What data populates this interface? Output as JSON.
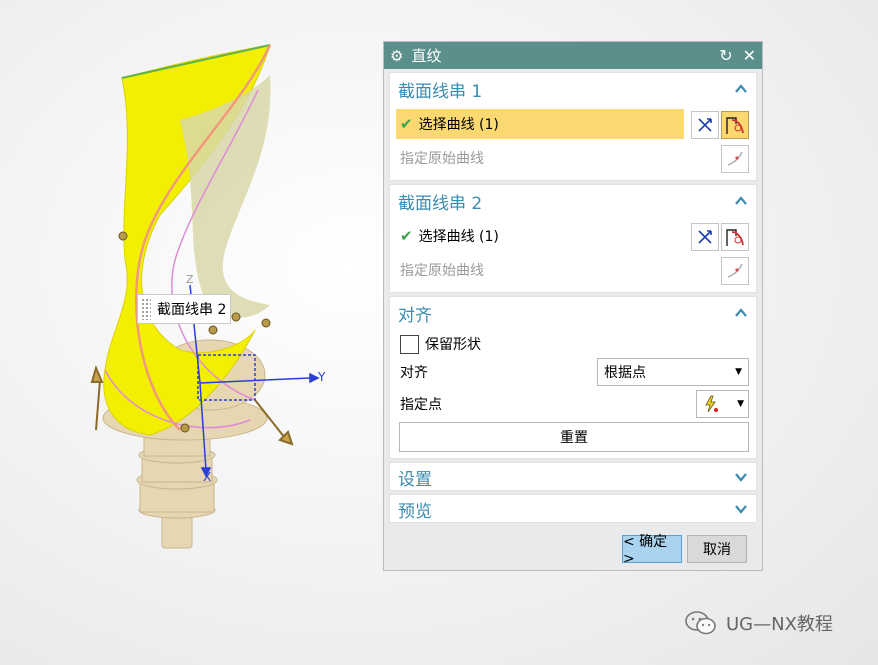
{
  "dialog": {
    "title": "直纹",
    "section1": {
      "title": "截面线串 1",
      "select_curve": "选择曲线 (1)",
      "specify_origin": "指定原始曲线"
    },
    "section2": {
      "title": "截面线串 2",
      "select_curve": "选择曲线 (1)",
      "specify_origin": "指定原始曲线"
    },
    "alignment": {
      "title": "对齐",
      "keep_shape_label": "保留形状",
      "align_label": "对齐",
      "align_value": "根据点",
      "specify_point_label": "指定点",
      "reset_label": "重置"
    },
    "settings_title": "设置",
    "preview_title": "预览",
    "ok_label": "< 确定 >",
    "cancel_label": "取消"
  },
  "viewport": {
    "tooltip": "截面线串 2",
    "axes": {
      "x": "X",
      "y": "Y",
      "z": "Z"
    }
  },
  "watermark": "UG—NX教程",
  "colors": {
    "titlebar": "#5b8f8c",
    "section_title": "#3a8bb0",
    "selection_highlight": "#fbd870",
    "surface": "#f2ef00",
    "ok_button": "#a9d3ef"
  }
}
